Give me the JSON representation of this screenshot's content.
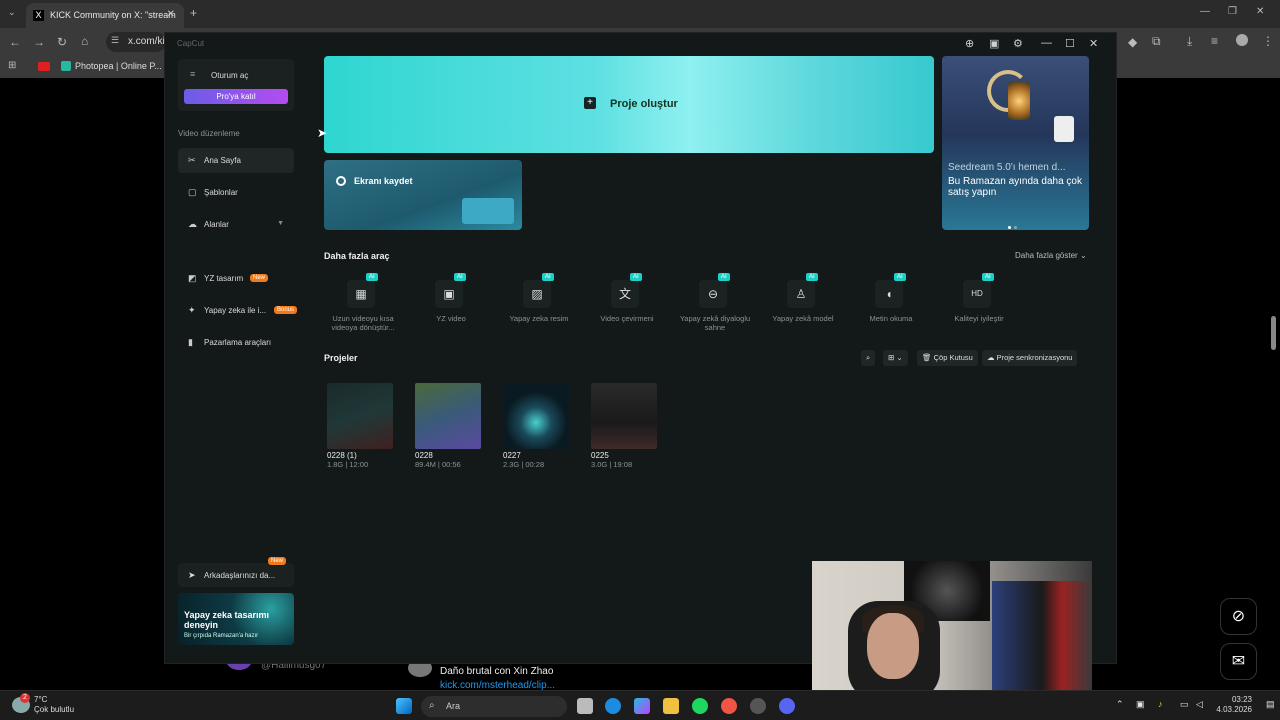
{
  "browser": {
    "tab_title": "KICK Community on X: \"stream",
    "tab_icon": "x-logo-icon",
    "url": "x.com/ki",
    "bookmark": "Photopea | Online P..."
  },
  "capcut": {
    "app_name": "CapCut",
    "sidebar": {
      "login": "Oturum aç",
      "pro_button": "Pro'ya katıl",
      "section": "Video düzenleme",
      "items": [
        {
          "label": "Ana Sayfa",
          "icon": "scissors-icon"
        },
        {
          "label": "Şablonlar",
          "icon": "template-icon"
        },
        {
          "label": "Alanlar",
          "icon": "cloud-icon"
        },
        {
          "label": "YZ tasarım",
          "icon": "design-icon",
          "badge": "New"
        },
        {
          "label": "Yapay zeka ile i...",
          "icon": "magic-wand-icon",
          "badge": "Bonus"
        },
        {
          "label": "Pazarlama araçları",
          "icon": "marketing-icon"
        }
      ],
      "invite": "Arkadaşlarınızı da...",
      "invite_badge": "New",
      "promo_title": "Yapay zeka tasarımı deneyin",
      "promo_sub": "Bir çırpıda Ramazan'a hazır"
    },
    "hero": {
      "label": "Proje oluştur"
    },
    "record": {
      "label": "Ekranı kaydet"
    },
    "banner": {
      "line1": "Seedream 5.0'ı hemen d...",
      "line2": "Bu Ramazan ayında daha çok satış yapın"
    },
    "tools_section": {
      "title": "Daha fazla araç",
      "more": "Daha fazla göster",
      "ai_badge": "AI",
      "tools": [
        {
          "label": "Uzun videoyu kısa videoya dönüştür...",
          "icon": "film-icon"
        },
        {
          "label": "YZ video",
          "icon": "ai-video-icon"
        },
        {
          "label": "Yapay zeka resim",
          "icon": "image-icon"
        },
        {
          "label": "Video çevirmeni",
          "icon": "translate-icon"
        },
        {
          "label": "Yapay zekâ diyaloglu sahne",
          "icon": "dialogue-icon"
        },
        {
          "label": "Yapay zekâ model",
          "icon": "shirt-icon"
        },
        {
          "label": "Metin okuma",
          "icon": "voice-icon"
        },
        {
          "label": "Kaliteyi iyileştir",
          "icon": "hd-icon"
        }
      ]
    },
    "projects_section": {
      "title": "Projeler",
      "trash": "Çöp Kutusu",
      "sync": "Proje senkronizasyonu",
      "projects": [
        {
          "name": "0228 (1)",
          "meta": "1.8G | 12:00"
        },
        {
          "name": "0228",
          "meta": "89.4M | 00:56"
        },
        {
          "name": "0227",
          "meta": "2.3G | 00:28"
        },
        {
          "name": "0225",
          "meta": "3.0G | 19:08"
        }
      ]
    }
  },
  "behind": {
    "handle": "@Halilmusg07",
    "tweet_text": "Daño brutal con Xin Zhao",
    "tweet_link": "kick.com/msterhead/clip..."
  },
  "taskbar": {
    "temp": "7°C",
    "weather": "Çok bulutlu",
    "search": "Ara",
    "time": "03:23",
    "date": "4.03.2026",
    "notif_count": "2"
  }
}
